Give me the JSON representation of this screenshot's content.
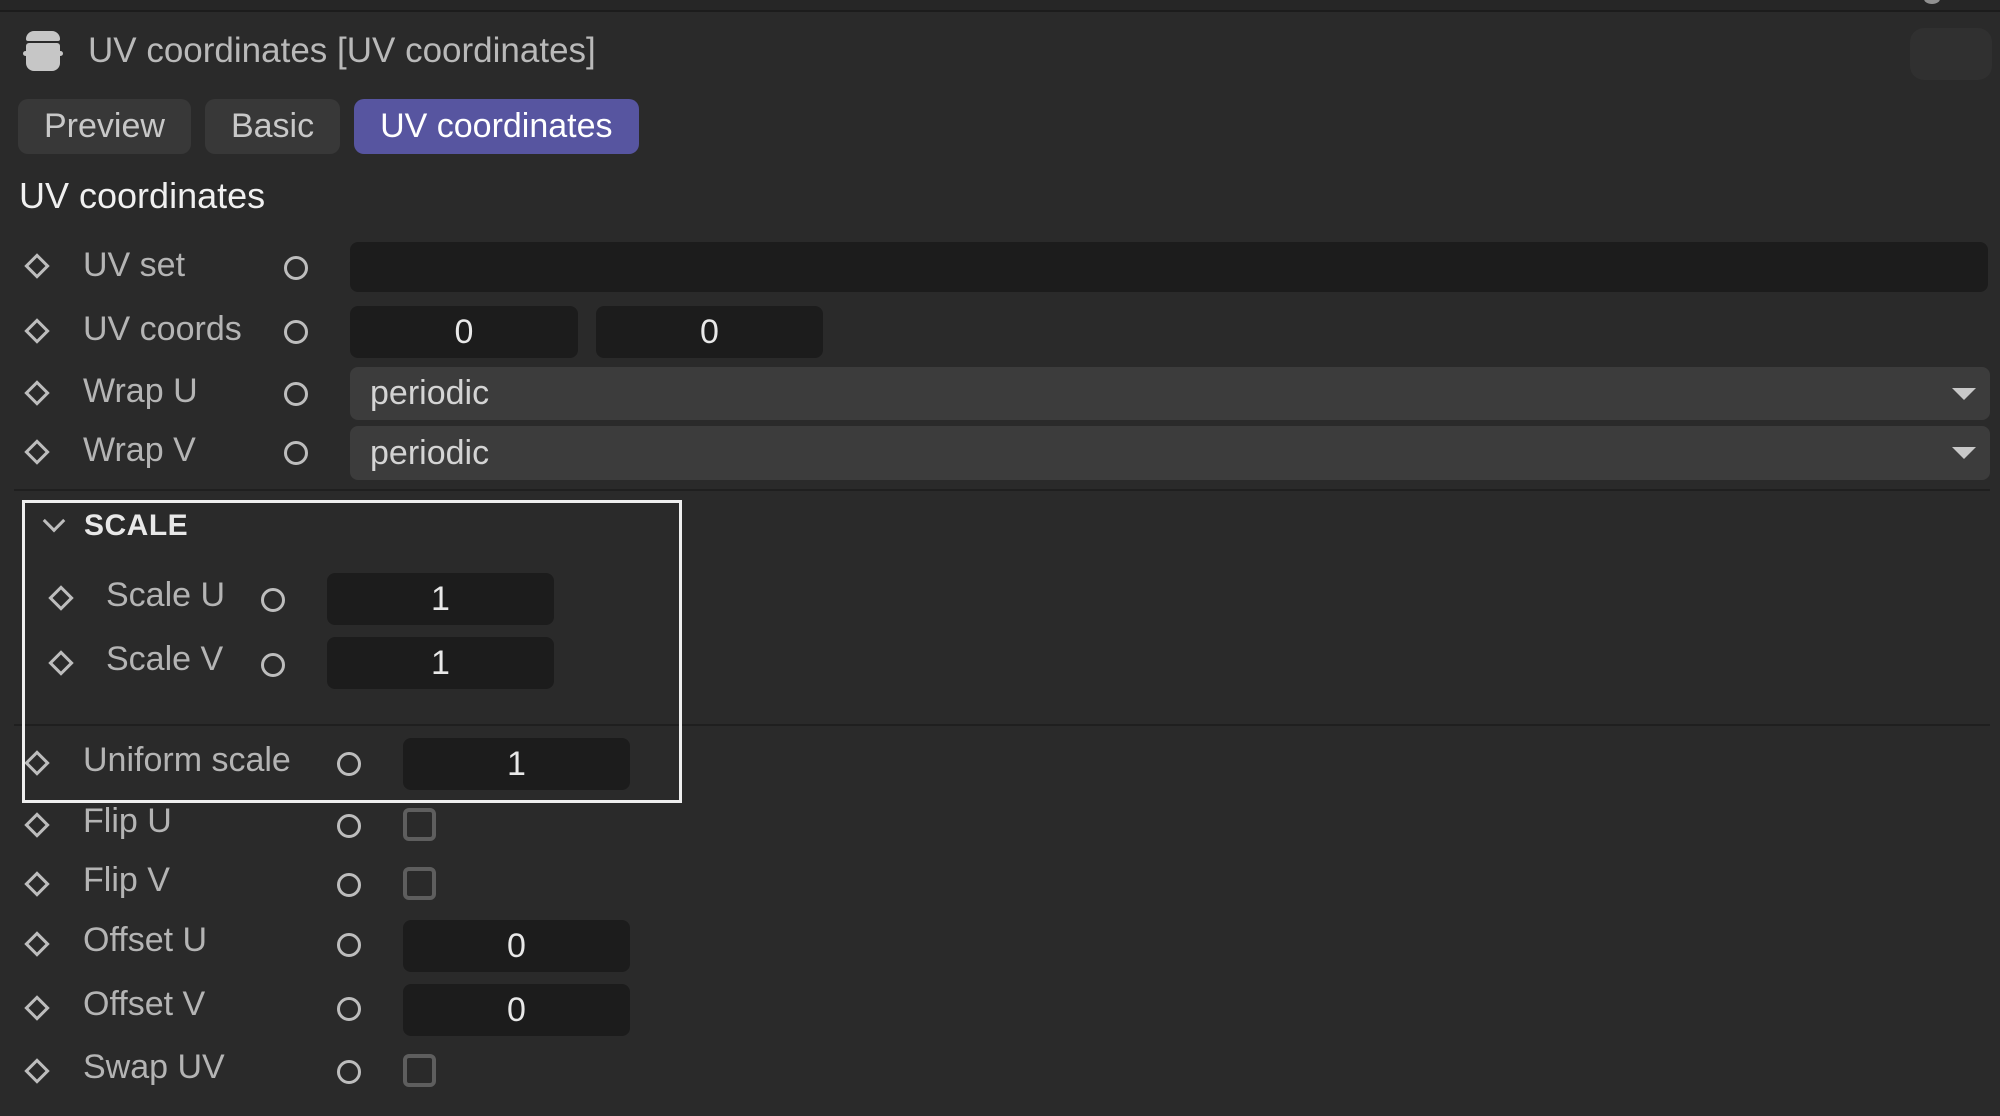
{
  "header": {
    "icon": "material-node-icon",
    "title": "UV coordinates [UV coordinates]"
  },
  "tabs": [
    {
      "label": "Preview",
      "active": false
    },
    {
      "label": "Basic",
      "active": false
    },
    {
      "label": "UV coordinates",
      "active": true
    }
  ],
  "colors": {
    "accent": "#5755a0",
    "background": "#2a2a2a",
    "field_bg": "#1c1c1c",
    "dropdown_bg": "#3c3c3c"
  },
  "section": {
    "title": "UV coordinates"
  },
  "params": {
    "uv_set": {
      "label": "UV set",
      "value": ""
    },
    "uv_coords": {
      "label": "UV coords",
      "value_u": "0",
      "value_v": "0"
    },
    "wrap_u": {
      "label": "Wrap U",
      "value": "periodic"
    },
    "wrap_v": {
      "label": "Wrap V",
      "value": "periodic"
    }
  },
  "scale_group": {
    "title": "SCALE",
    "expanded": true,
    "scale_u": {
      "label": "Scale U",
      "value": "1"
    },
    "scale_v": {
      "label": "Scale V",
      "value": "1"
    }
  },
  "params2": {
    "uniform_scale": {
      "label": "Uniform scale",
      "value": "1"
    },
    "flip_u": {
      "label": "Flip U",
      "checked": false
    },
    "flip_v": {
      "label": "Flip V",
      "checked": false
    },
    "offset_u": {
      "label": "Offset U",
      "value": "0"
    },
    "offset_v": {
      "label": "Offset V",
      "value": "0"
    },
    "swap_uv": {
      "label": "Swap UV",
      "checked": false
    }
  }
}
